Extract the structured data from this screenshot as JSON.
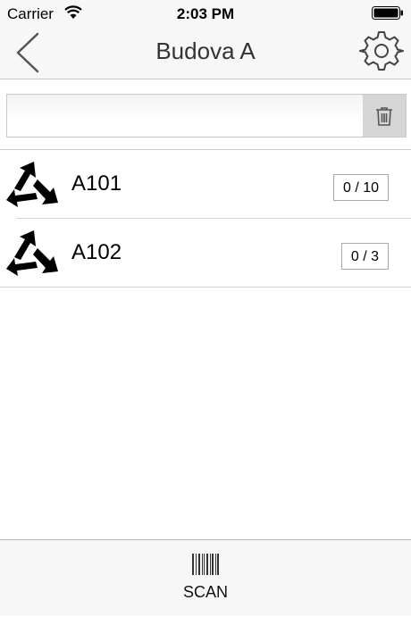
{
  "status_bar": {
    "carrier": "Carrier",
    "time": "2:03 PM"
  },
  "nav": {
    "title": "Budova A",
    "back_icon": "chevron-left-icon",
    "settings_icon": "gear-icon"
  },
  "search": {
    "value": "",
    "clear_icon": "trash-icon"
  },
  "rooms": [
    {
      "name": "A101",
      "count": "0 / 10",
      "icon": "recycle-arrows-icon"
    },
    {
      "name": "A102",
      "count": "0 / 3",
      "icon": "recycle-arrows-icon"
    }
  ],
  "toolbar": {
    "scan_label": "SCAN",
    "scan_icon": "barcode-icon"
  },
  "colors": {
    "bar_background": "#f7f7f7",
    "clear_button": "#d6d6d6",
    "separator": "#d6d6d6"
  }
}
